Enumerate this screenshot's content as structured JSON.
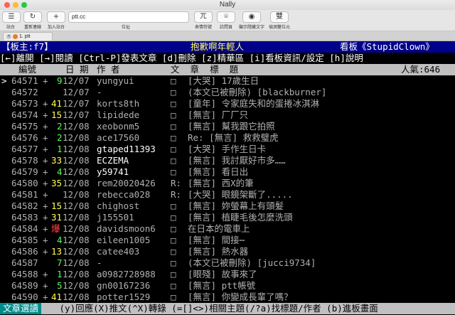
{
  "window": {
    "title": "Nally"
  },
  "toolbar": {
    "buttons": [
      {
        "label": "站台",
        "icon": "sites-icon",
        "glyph": "☰"
      },
      {
        "label": "重新連線",
        "icon": "reconnect-icon",
        "glyph": "↻"
      },
      {
        "label": "加入站台",
        "icon": "add-site-icon",
        "glyph": "+"
      }
    ],
    "address_value": "ptt.cc",
    "address_caption": "位址",
    "right_buttons": [
      {
        "label": "表情符號",
        "icon": "emoticon-icon",
        "glyph": "ㄫ"
      },
      {
        "label": "訪問頁",
        "icon": "visit-page-icon",
        "glyph": "⌾"
      },
      {
        "label": "顯示隱藏文字",
        "icon": "eye-icon",
        "glyph": "◉"
      },
      {
        "label": "偵測雙位元",
        "icon": "double-byte-icon",
        "glyph": "雙"
      }
    ]
  },
  "tab": {
    "label": "1. ptt"
  },
  "board": {
    "header_left": "【板主:f7】",
    "header_center": "抱歉啊年輕人",
    "header_right": "看板《StupidClown》",
    "help_line": "[←]離開 [→]閱讀 [Ctrl-P]發表文章 [d]刪除 [z]精華區 [i]看板資訊/設定 [h]說明",
    "column_headers": {
      "num": "編號",
      "date": "日 期",
      "author": "作 者",
      "title": "文  章  標  題",
      "popularity": "人氣:646"
    },
    "cursor": ">",
    "posts": [
      {
        "num": "64571",
        "mark": "+",
        "push": "9",
        "date": "12/07",
        "author": "yungyui",
        "box": "□",
        "category": "",
        "title": "[大哭] 17歲生日"
      },
      {
        "num": "64572",
        "mark": " ",
        "push": " ",
        "date": "12/07",
        "author": "-",
        "box": "□",
        "category": "",
        "title": "(本文已被刪除) [blackburner]"
      },
      {
        "num": "64573",
        "mark": "+",
        "push": "41",
        "date": "12/07",
        "author": "korts8th",
        "box": "□",
        "category": "",
        "title": "[童年] 令家庭失和的蛋捲冰淇淋"
      },
      {
        "num": "64574",
        "mark": "+",
        "push": "15",
        "date": "12/07",
        "author": "lipidede",
        "box": "□",
        "category": "",
        "title": "[無言] 厂厂只"
      },
      {
        "num": "64575",
        "mark": "+",
        "push": "2",
        "date": "12/08",
        "author": "xeobonm5",
        "box": "□",
        "category": "",
        "title": "[無言] 幫我跟它拍照"
      },
      {
        "num": "64576",
        "mark": "+",
        "push": "2",
        "date": "12/08",
        "author": "ace17560",
        "box": "□",
        "category": "",
        "title": "Re: [無言] 救救璧虎"
      },
      {
        "num": "64577",
        "mark": "+",
        "push": "1",
        "date": "12/08",
        "author": "gtaped11393",
        "box": "□",
        "category": "",
        "title": "[大哭] 手作生日卡"
      },
      {
        "num": "64578",
        "mark": "+",
        "push": "33",
        "date": "12/08",
        "author": "ECZEMA",
        "box": "□",
        "category": "",
        "title": "[無言] 我討厭好市多……"
      },
      {
        "num": "64579",
        "mark": "+",
        "push": "4",
        "date": "12/08",
        "author": "y59741",
        "box": "□",
        "category": "",
        "title": "[無言] 看日出"
      },
      {
        "num": "64580",
        "mark": "+",
        "push": "35",
        "date": "12/08",
        "author": "rem20020426",
        "box": "R:",
        "category": "",
        "title": "[無言] 西X的筆"
      },
      {
        "num": "64581",
        "mark": "+",
        "push": " ",
        "date": "12/08",
        "author": "rebecca028",
        "box": "R:",
        "category": "",
        "title": "[大哭] 眼鏡架斷了....."
      },
      {
        "num": "64582",
        "mark": "+",
        "push": "15",
        "date": "12/08",
        "author": "chighost",
        "box": "□",
        "category": "",
        "title": "[無言] 妳螢幕上有頭髮"
      },
      {
        "num": "64583",
        "mark": "+",
        "push": "31",
        "date": "12/08",
        "author": "j155501",
        "box": "□",
        "category": "",
        "title": "[無言] 植睫毛後怎麼洗頭"
      },
      {
        "num": "64584",
        "mark": "+",
        "push": "爆",
        "date": "12/08",
        "author": "davidsmoon6",
        "box": "□",
        "category": "",
        "title": "在日本的電車上"
      },
      {
        "num": "64585",
        "mark": "+",
        "push": "4",
        "date": "12/08",
        "author": "eileen1005",
        "box": "□",
        "category": "",
        "title": "[無言] 間接⋯"
      },
      {
        "num": "64586",
        "mark": "+",
        "push": "13",
        "date": "12/08",
        "author": "catee403",
        "box": "□",
        "category": "",
        "title": "[無言] 熱水器"
      },
      {
        "num": "64587",
        "mark": " ",
        "push": "7",
        "date": "12/08",
        "author": "-",
        "box": "□",
        "category": "",
        "title": "(本文已被刪除) [jucci9734]"
      },
      {
        "num": "64588",
        "mark": "+",
        "push": "1",
        "date": "12/08",
        "author": "a0982728988",
        "box": "□",
        "category": "",
        "title": "[眼殘] 故事來了"
      },
      {
        "num": "64589",
        "mark": "+",
        "push": "5",
        "date": "12/08",
        "author": "gn00167236",
        "box": "□",
        "category": "",
        "title": "[無言] ptt帳號"
      },
      {
        "num": "64590",
        "mark": "+",
        "push": "41",
        "date": "12/08",
        "author": "potter1529",
        "box": "□",
        "category": "",
        "title": "[無言] 你變成長輩了嗎？"
      }
    ],
    "footer_left": "文章選讀",
    "footer_right": " (y)回應(X)推文(^X)轉錄 (=[]<>)相關主題(/?a)找標題/作者 (b)進板畫面"
  },
  "colors": {
    "header_bg": "#00008b",
    "push_yellow": "#ffff55",
    "push_green": "#55ff55",
    "push_red": "#ff4444",
    "footer_cyan": "#008b8b"
  }
}
